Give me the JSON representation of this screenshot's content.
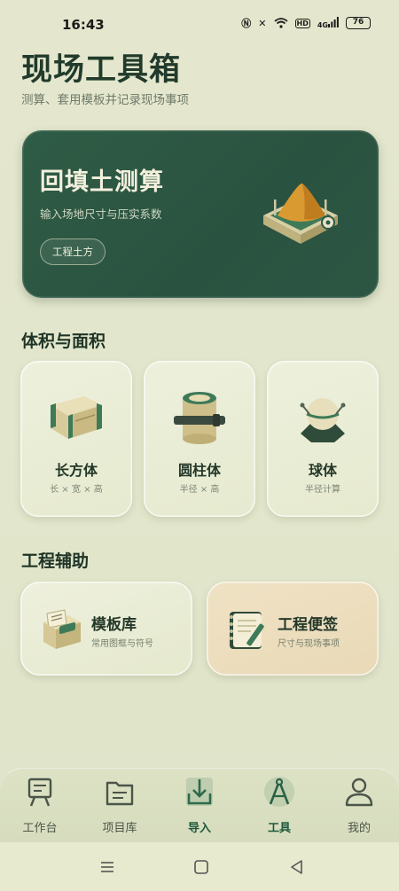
{
  "status": {
    "time": "16:43",
    "battery": "76",
    "net_label": "4G",
    "hd_label": "HD"
  },
  "header": {
    "title": "现场工具箱",
    "subtitle": "测算、套用模板并记录现场事项"
  },
  "hero": {
    "title": "回填土测算",
    "desc": "输入场地尺寸与压实系数",
    "tag": "工程土方",
    "icon": "sand-pile-icon"
  },
  "volume_section": {
    "title": "体积与面积",
    "cards": [
      {
        "name": "长方体",
        "formula": "长 × 宽 × 高",
        "icon": "cuboid-icon"
      },
      {
        "name": "圆柱体",
        "formula": "半径 × 高",
        "icon": "cylinder-icon"
      },
      {
        "name": "球体",
        "formula": "半径计算",
        "icon": "sphere-icon"
      }
    ]
  },
  "aux_section": {
    "title": "工程辅助",
    "cards": [
      {
        "name": "模板库",
        "desc": "常用图框与符号",
        "icon": "template-box-icon"
      },
      {
        "name": "工程便签",
        "desc": "尺寸与现场事项",
        "icon": "notebook-icon"
      }
    ]
  },
  "nav": {
    "active": "工具",
    "items": [
      {
        "label": "工作台",
        "icon": "easel-icon"
      },
      {
        "label": "项目库",
        "icon": "folder-icon"
      },
      {
        "label": "导入",
        "icon": "import-icon"
      },
      {
        "label": "工具",
        "icon": "compass-icon"
      },
      {
        "label": "我的",
        "icon": "user-icon"
      }
    ]
  },
  "colors": {
    "accent": "#2c5542",
    "background": "#e3e6cc",
    "active_nav": "#1f5a3c",
    "note_card": "#ecdcbd"
  }
}
